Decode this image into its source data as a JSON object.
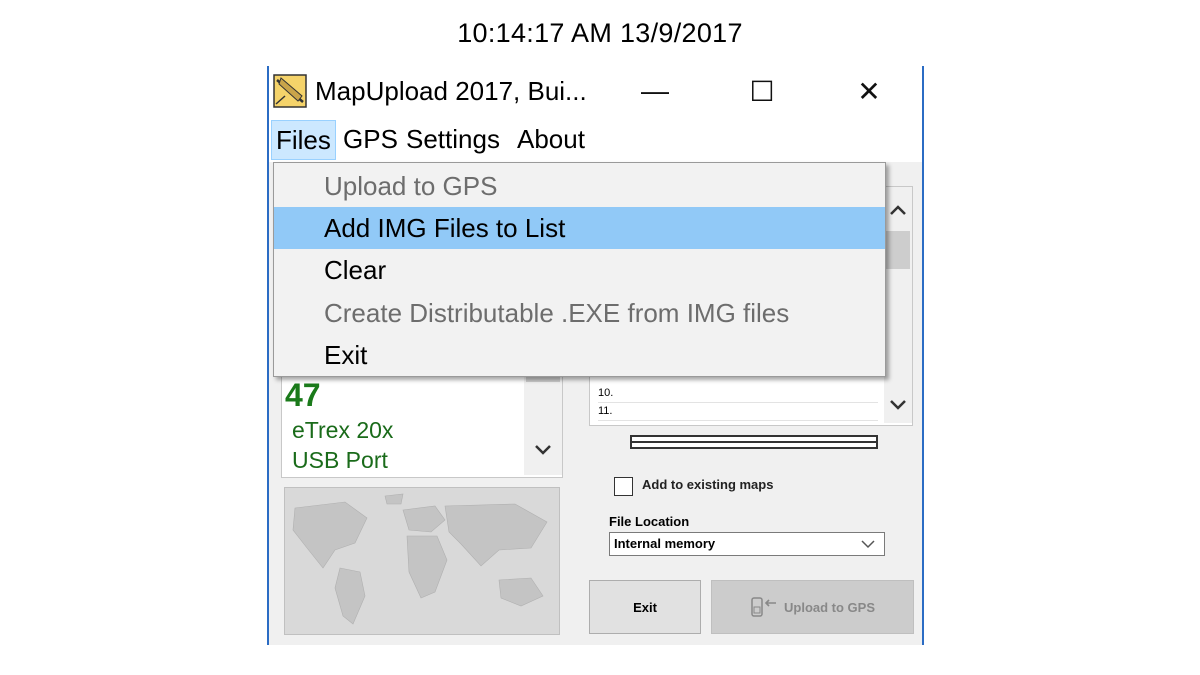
{
  "clock": {
    "text": "10:14:17 AM 13/9/2017"
  },
  "window": {
    "title": "MapUpload 2017, Bui...",
    "controls": {
      "minimize": "—",
      "maximize": "☐",
      "close": "✕"
    }
  },
  "menubar": {
    "items": [
      "Files",
      "GPS",
      "Settings",
      "About"
    ],
    "open_index": 0
  },
  "files_menu": {
    "items": [
      {
        "label": "Upload to GPS",
        "enabled": false
      },
      {
        "label": "Add IMG Files to List",
        "enabled": true,
        "highlighted": true
      },
      {
        "label": "Clear",
        "enabled": true
      },
      {
        "label": "Create Distributable .EXE from IMG files",
        "enabled": false
      },
      {
        "label": "Exit",
        "enabled": true
      }
    ]
  },
  "device_panel": {
    "count": "47",
    "device": "eTrex 20x",
    "port": "USB Port"
  },
  "map_list": {
    "visible_rows": [
      "10.",
      "11."
    ]
  },
  "options": {
    "add_existing_label": "Add to existing maps",
    "add_existing_checked": false,
    "file_location_label": "File Location",
    "file_location_value": "Internal memory"
  },
  "buttons": {
    "exit_label": "Exit",
    "upload_label": "Upload to GPS"
  },
  "icons": {
    "app": "mapupload-app-icon",
    "scroll_up": "chevron-up-icon",
    "scroll_down": "chevron-down-icon",
    "select_arrow": "chevron-down-icon",
    "upload": "gps-upload-icon"
  },
  "colors": {
    "accent": "#91c9f7",
    "menu_open": "#cce8ff",
    "device_text": "#1a7a1a",
    "window_border": "#2b6cc4"
  }
}
